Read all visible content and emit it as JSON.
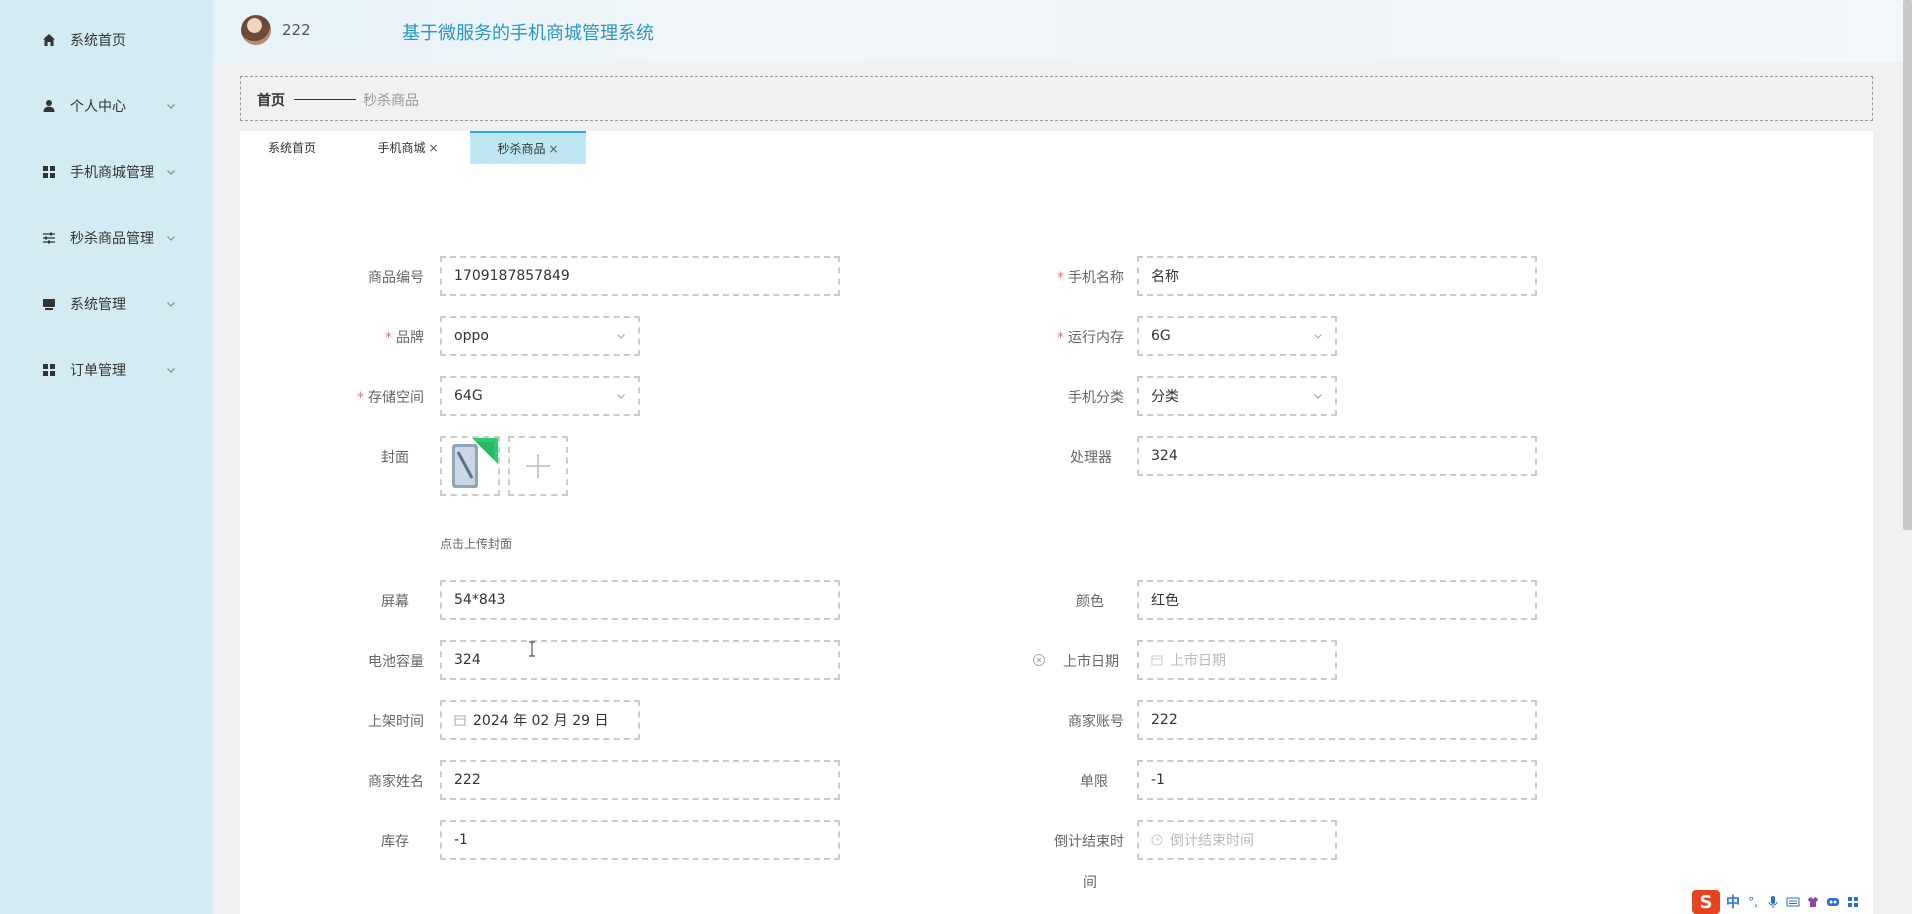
{
  "header": {
    "username": "222",
    "title": "基于微服务的手机商城管理系统"
  },
  "sidebar": {
    "items": [
      {
        "label": "系统首页",
        "icon": "home-icon",
        "expandable": false
      },
      {
        "label": "个人中心",
        "icon": "user-icon",
        "expandable": true
      },
      {
        "label": "手机商城管理",
        "icon": "grid-icon",
        "expandable": true
      },
      {
        "label": "秒杀商品管理",
        "icon": "sliders-icon",
        "expandable": true
      },
      {
        "label": "系统管理",
        "icon": "monitor-icon",
        "expandable": true
      },
      {
        "label": "订单管理",
        "icon": "grid-icon",
        "expandable": true
      }
    ]
  },
  "breadcrumb": {
    "home": "首页",
    "current": "秒杀商品"
  },
  "tabs": [
    {
      "label": "系统首页",
      "closable": false,
      "active": false
    },
    {
      "label": "手机商城",
      "closable": true,
      "active": false
    },
    {
      "label": "秒杀商品",
      "closable": true,
      "active": true
    }
  ],
  "tab_close_glyph": "×",
  "form": {
    "required_mark": "*",
    "fields": {
      "product_no": {
        "label": "商品编号",
        "value": "1709187857849"
      },
      "phone_name": {
        "label": "手机名称",
        "value": "名称",
        "required": true
      },
      "brand": {
        "label": "品牌",
        "value": "oppo",
        "required": true
      },
      "ram": {
        "label": "运行内存",
        "value": "6G",
        "required": true
      },
      "storage": {
        "label": "存储空间",
        "value": "64G",
        "required": true
      },
      "category": {
        "label": "手机分类",
        "value": "分类"
      },
      "cover": {
        "label": "封面",
        "hint": "点击上传封面"
      },
      "processor": {
        "label": "处理器",
        "value": "324"
      },
      "screen": {
        "label": "屏幕",
        "value": "54*843"
      },
      "color": {
        "label": "颜色",
        "value": "红色"
      },
      "battery": {
        "label": "电池容量",
        "value": "324"
      },
      "release_date": {
        "label": "上市日期",
        "placeholder": "上市日期"
      },
      "listing_time": {
        "label": "上架时间",
        "value": "2024 年 02 月 29 日"
      },
      "merchant_account": {
        "label": "商家账号",
        "value": "222"
      },
      "merchant_name": {
        "label": "商家姓名",
        "value": "222"
      },
      "limit": {
        "label": "单限",
        "value": "-1"
      },
      "stock": {
        "label": "库存",
        "value": "-1"
      },
      "countdown_end": {
        "label_line1": "倒计结束时",
        "label_line2": "间",
        "placeholder": "倒计结束时间"
      }
    }
  },
  "ime": {
    "logo": "S",
    "mode": "中"
  },
  "colors": {
    "sidebar_bg": "#d3ecf3",
    "accent": "#2ea9d8",
    "title": "#2a96c3",
    "required": "#f56c6c"
  }
}
